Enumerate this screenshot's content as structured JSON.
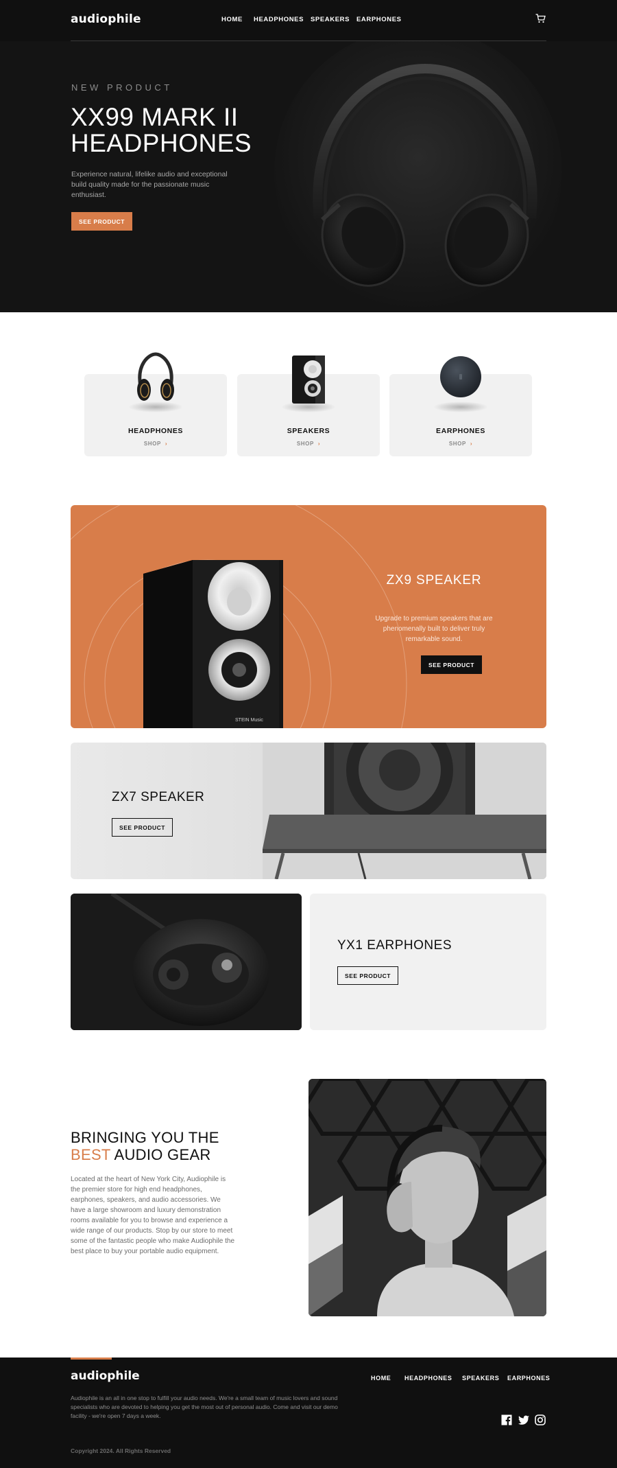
{
  "header": {
    "logo": "audiophile",
    "nav": [
      "HOME",
      "HEADPHONES",
      "SPEAKERS",
      "EARPHONES"
    ],
    "cart_icon": "cart-icon"
  },
  "hero": {
    "eyebrow": "NEW PRODUCT",
    "title": "XX99 MARK II HEADPHONES",
    "text": "Experience natural, lifelike audio and exceptional build quality made for the passionate music enthusiast.",
    "button": "SEE PRODUCT"
  },
  "categories": [
    {
      "title": "HEADPHONES",
      "shop": "SHOP"
    },
    {
      "title": "SPEAKERS",
      "shop": "SHOP"
    },
    {
      "title": "EARPHONES",
      "shop": "SHOP"
    }
  ],
  "zx9": {
    "title": "ZX9 SPEAKER",
    "text": "Upgrade to premium speakers that are phenomenally built to deliver truly remarkable sound.",
    "button": "SEE PRODUCT",
    "speaker_brand": "STEIN Music"
  },
  "zx7": {
    "title": "ZX7 SPEAKER",
    "button": "SEE PRODUCT"
  },
  "yx1": {
    "title": "YX1 EARPHONES",
    "button": "SEE PRODUCT"
  },
  "about": {
    "title_pre": "BRINGING YOU THE",
    "title_accent": "BEST",
    "title_post": "AUDIO GEAR",
    "text": "Located at the heart of New York City, Audiophile is the premier store for high end headphones, earphones, speakers, and audio accessories. We have a large showroom and luxury demonstration rooms available for you to browse and experience a wide range of our products. Stop by our store to meet some of the fantastic people who make Audiophile the best place to buy your portable audio equipment."
  },
  "footer": {
    "logo": "audiophile",
    "nav": [
      "HOME",
      "HEADPHONES",
      "SPEAKERS",
      "EARPHONES"
    ],
    "text": "Audiophile is an all in one stop to fulfill your audio needs. We're a small team of music lovers and sound specialists who are devoted to helping you get the most out of personal audio. Come and visit our demo facility - we're open 7 days a week.",
    "copyright": "Copyright 2024. All Rights Reserved",
    "social": [
      "facebook-icon",
      "twitter-icon",
      "instagram-icon"
    ]
  },
  "colors": {
    "accent": "#D87D4A",
    "dark": "#101010",
    "light_gray": "#F1F1F1"
  }
}
